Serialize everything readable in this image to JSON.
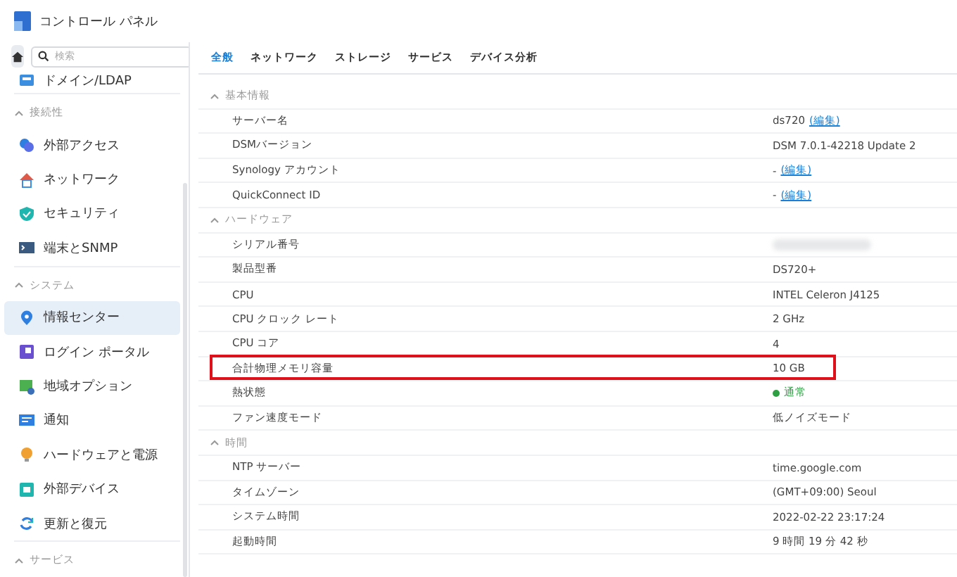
{
  "window": {
    "title": "コントロール パネル"
  },
  "sidebar": {
    "search": {
      "placeholder": "検索"
    },
    "sections": [
      {
        "items": [
          {
            "label": "ドメイン/LDAP",
            "selected": false
          }
        ]
      },
      {
        "header": "接続性",
        "items": [
          {
            "label": "外部アクセス",
            "selected": false
          },
          {
            "label": "ネットワーク",
            "selected": false
          },
          {
            "label": "セキュリティ",
            "selected": false
          },
          {
            "label": "端末とSNMP",
            "selected": false
          }
        ]
      },
      {
        "header": "システム",
        "items": [
          {
            "label": "情報センター",
            "selected": true
          },
          {
            "label": "ログイン ポータル",
            "selected": false
          },
          {
            "label": "地域オプション",
            "selected": false
          },
          {
            "label": "通知",
            "selected": false
          },
          {
            "label": "ハードウェアと電源",
            "selected": false
          },
          {
            "label": "外部デバイス",
            "selected": false
          },
          {
            "label": "更新と復元",
            "selected": false
          }
        ]
      },
      {
        "header": "サービス"
      }
    ]
  },
  "tabs": [
    {
      "label": "全般",
      "selected": true
    },
    {
      "label": "ネットワーク",
      "selected": false
    },
    {
      "label": "ストレージ",
      "selected": false
    },
    {
      "label": "サービス",
      "selected": false
    },
    {
      "label": "デバイス分析",
      "selected": false
    }
  ],
  "groups": [
    {
      "title": "基本情報",
      "expanded": true,
      "rows": [
        {
          "label": "サーバー名",
          "value": "ds720",
          "link": "(編集)"
        },
        {
          "label": "DSMバージョン",
          "value": "DSM 7.0.1-42218 Update 2"
        },
        {
          "label": "Synology アカウント",
          "value": "-",
          "link": "(編集)"
        },
        {
          "label": "QuickConnect ID",
          "value": "-",
          "link": "(編集)"
        }
      ]
    },
    {
      "title": "ハードウェア",
      "expanded": true,
      "rows": [
        {
          "label": "シリアル番号",
          "blurred": true
        },
        {
          "label": "製品型番",
          "value": "DS720+"
        },
        {
          "label": "CPU",
          "value": "INTEL Celeron J4125"
        },
        {
          "label": "CPU クロック レート",
          "value": "2 GHz"
        },
        {
          "label": "CPU コア",
          "value": "4"
        },
        {
          "label": "合計物理メモリ容量",
          "value": "10 GB",
          "highlighted": true
        },
        {
          "label": "熱状態",
          "value": "通常",
          "color": "#2ea043"
        },
        {
          "label": "ファン速度モード",
          "value": "低ノイズモード"
        }
      ]
    },
    {
      "title": "時間",
      "expanded": true,
      "rows": [
        {
          "label": "NTP サーバー",
          "value": "time.google.com"
        },
        {
          "label": "タイムゾーン",
          "value": "(GMT+09:00) Seoul"
        },
        {
          "label": "システム時間",
          "value": "2022-02-22 23:17:24"
        },
        {
          "label": "起動時間",
          "value": "9 時間 19 分 42 秒"
        }
      ]
    }
  ]
}
